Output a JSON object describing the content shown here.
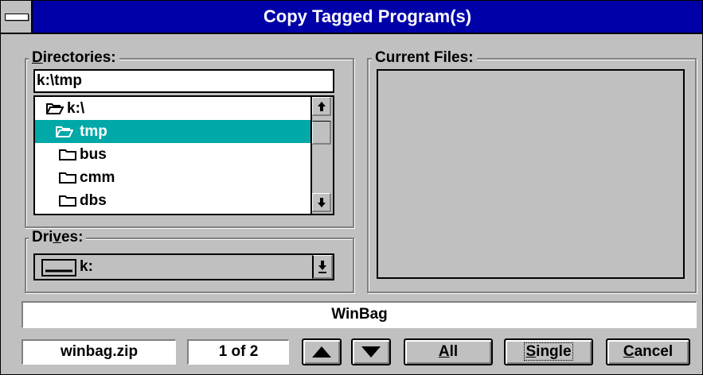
{
  "dialog": {
    "title": "Copy Tagged Program(s)"
  },
  "directories": {
    "label_prefix": "D",
    "label_rest": "irectories:",
    "path": "k:\\tmp",
    "items": [
      {
        "label": "k:\\",
        "icon": "folder-open-icon",
        "selected": false
      },
      {
        "label": "tmp",
        "icon": "folder-open-icon",
        "selected": true
      },
      {
        "label": "bus",
        "icon": "folder-icon",
        "selected": false
      },
      {
        "label": "cmm",
        "icon": "folder-icon",
        "selected": false
      },
      {
        "label": "dbs",
        "icon": "folder-icon",
        "selected": false
      }
    ]
  },
  "drives": {
    "label_a": "Dri",
    "label_u": "v",
    "label_b": "es:",
    "selected": "k:"
  },
  "current_files": {
    "label": "Current Files:"
  },
  "program_name": "WinBag",
  "footer": {
    "filename": "winbag.zip",
    "counter": "1 of 2",
    "all_u": "A",
    "all_rest": "ll",
    "single_u": "S",
    "single_rest": "ingle",
    "cancel_u": "C",
    "cancel_rest": "ancel"
  },
  "colors": {
    "titlebar": "#0000a8",
    "selection": "#00a8a8",
    "face": "#c0c0c0"
  }
}
